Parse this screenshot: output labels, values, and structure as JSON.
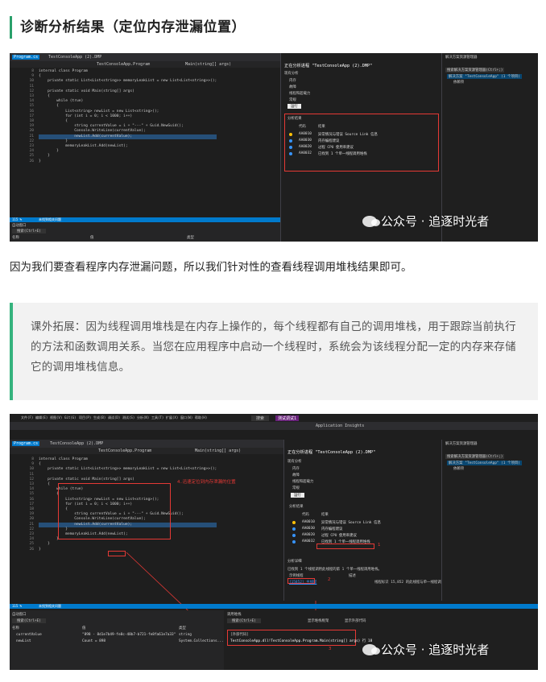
{
  "heading": "诊断分析结果（定位内存泄漏位置）",
  "paragraph": "因为我们要查看程序内存泄漏问题，所以我们针对性的查看线程调用堆栈结果即可。",
  "quote": "课外拓展：因为线程调用堆栈是在内存上操作的，每个线程都有自己的调用堆栈，用于跟踪当前执行的方法和函数调用关系。当您在应用程序中启动一个线程时，系统会为该线程分配一定的内存来存储它的调用堆栈信息。",
  "watermark": "公众号 · 追逐时光者",
  "screenshot1": {
    "tab_file": "Program.cs",
    "tab_dump": "TestConsoleApp (2).DMP",
    "nav_class": "TestConsoleApp.Program",
    "nav_method": "Main(string[] args)",
    "panel_title": "正在分析进程 \"TestConsoleApp (2).DMP\"",
    "analyzer_header": "现有分析",
    "analyzers": [
      "内存",
      "故障",
      "线程和超载力",
      "常规"
    ],
    "run_button": "运行",
    "results_header": "分析结果",
    "col_id": "代码",
    "col_result": "结果",
    "results": [
      {
        "code": "AA0010",
        "text": "异常情况与错误 Source Link 信息"
      },
      {
        "code": "AA0030",
        "text": "内存编程建议"
      },
      {
        "code": "AA0020",
        "text": "过程 CPU 使用率建议"
      },
      {
        "code": "AA0032",
        "text": "已找到 1 个单一线程调用堆栈"
      }
    ],
    "right_title": "解决方案资源管理器",
    "right_search": "搜索解决方案资源管理器(Ctrl+;)",
    "right_item1": "解决方案 \"TestConsoleApp\" (1 个项目)",
    "right_item2": "依赖项",
    "status": "未找到相关问题",
    "zoom": "115 %",
    "bottom_tab": "自动窗口",
    "bottom_search": "搜索(Ctrl+E)",
    "bottom_col_name": "名称",
    "bottom_col_value": "值",
    "bottom_col_type": "类型"
  },
  "code_lines": [
    "internal class Program",
    "{",
    "    private static List<List<string>> memoryLeakList = new List<List<string>>();",
    "",
    "    private static void Main(string[] args)",
    "    {",
    "        while (true)",
    "        {",
    "            List<string> newList = new List<string>();",
    "            for (int i = 0; i < 1000; i++)",
    "            {",
    "                string currentValue = i + \"---\" + Guid.NewGuid();",
    "                Console.WriteLine(currentValue);",
    "                newList.Add(currentValue);",
    "            }",
    "            memoryLeakList.Add(newList);",
    "        }",
    "    }",
    "}"
  ],
  "line_numbers": [
    "8",
    "9",
    "10",
    "11",
    "12",
    "13",
    "14",
    "15",
    "16",
    "17",
    "18",
    "19",
    "20",
    "21",
    "22",
    "23",
    "24",
    "25",
    "26"
  ],
  "screenshot2": {
    "menu": [
      "文件(F)",
      "编辑(E)",
      "视图(V)",
      "Git(G)",
      "项目(P)",
      "生成(B)",
      "调试(D)",
      "测试(S)",
      "分析(N)",
      "工具(T)",
      "扩展(X)",
      "窗口(W)",
      "帮助(H)"
    ],
    "search": "搜索",
    "project": "测试调试1",
    "app_insights": "Application Insights",
    "annotation1": "1",
    "annotation2": "2",
    "annotation3": "3",
    "annotation4": "4.迅速定位到内存泄漏的位置",
    "detail_header": "分析详细",
    "detail_text": "已找到 1 个线程调用此线程的第 1 个单一线程调用堆栈。",
    "detail_col1": "示例线程",
    "detail_col2": "描述",
    "detail_link": "[15852] 主线程",
    "detail_desc": "线程标识 15,852 的此线程与单一线程调用堆栈有关",
    "callstack_title": "调用堆栈",
    "callstack_entry": "TestConsoleApp.dll!TestConsoleApp.Program.Main(string[] args) 行 18",
    "callstack_header": "[外部代码]",
    "locals": [
      {
        "name": "currentValue",
        "value": "\"898 - 8d1e7b49-fe8c-48b7-b721-fe8fa61e7a33\"",
        "type": "string"
      },
      {
        "name": "newList",
        "value": "Count = 898",
        "type": "System.Collections..."
      }
    ],
    "right_btn1": "显示堆栈框架",
    "right_btn2": "显示外部代码"
  },
  "colors": {
    "accent": "#2aa06b",
    "quote_border": "#36b37e",
    "annotation": "#e53935"
  }
}
